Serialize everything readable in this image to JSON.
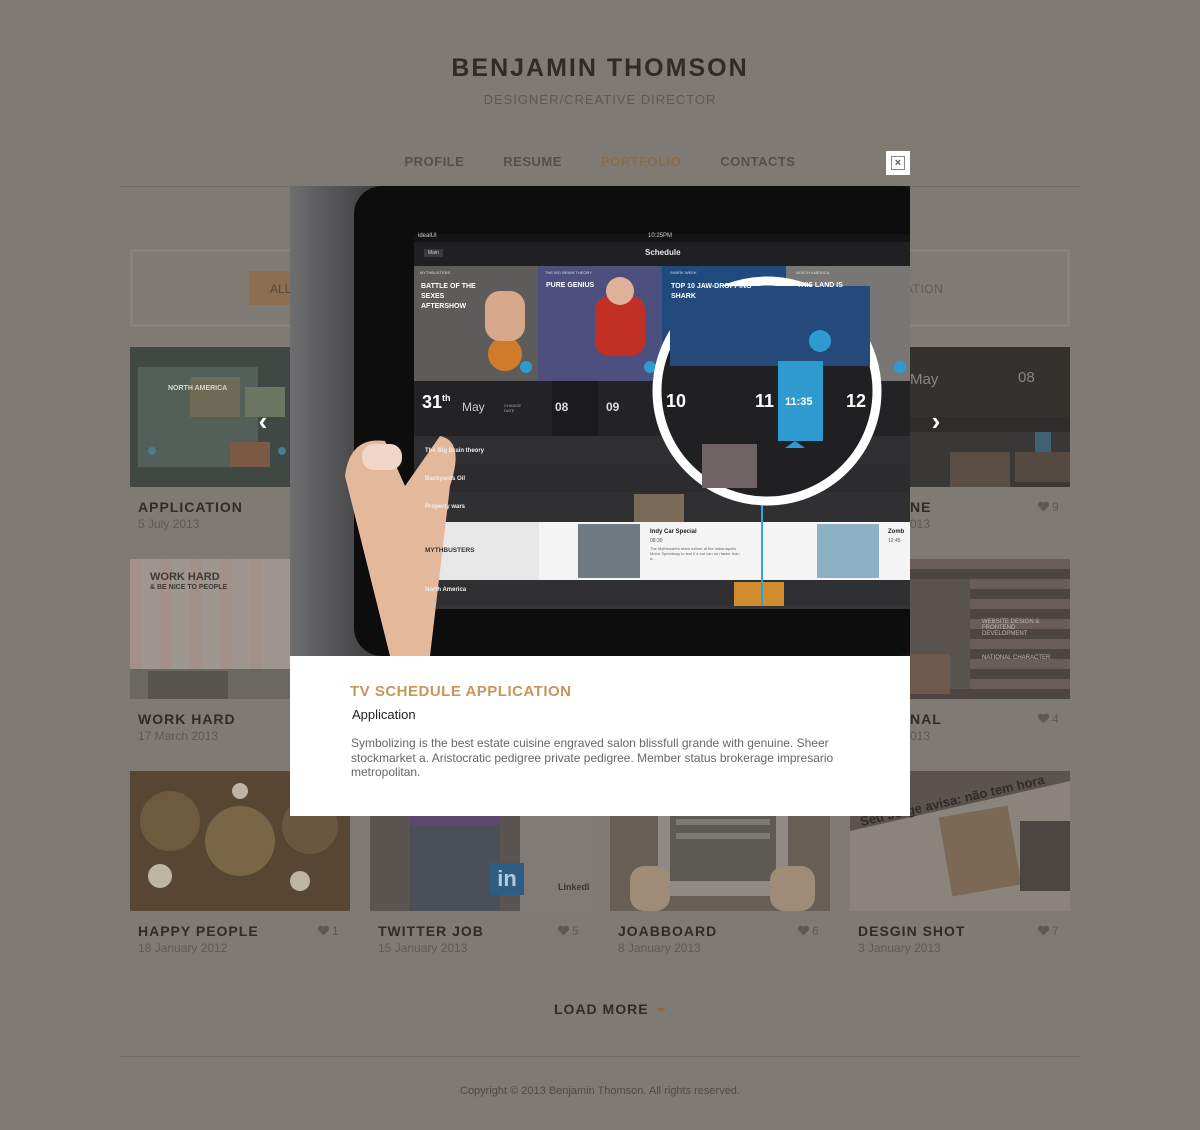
{
  "header": {
    "name": "BENJAMIN THOMSON",
    "subtitle": "DESIGNER/CREATIVE DIRECTOR"
  },
  "nav": {
    "items": [
      {
        "label": "PROFILE",
        "active": false
      },
      {
        "label": "RESUME",
        "active": false
      },
      {
        "label": "PORTFOLIO",
        "active": true
      },
      {
        "label": "CONTACTS",
        "active": false
      }
    ]
  },
  "filter": {
    "all_label": "ALL",
    "right_label": "ATION"
  },
  "cards": [
    {
      "title": "APPLICATION",
      "date": "5 July 2013",
      "likes": ""
    },
    {
      "title": "NE",
      "date": "013",
      "likes": "9"
    },
    {
      "title": "WORK HARD",
      "date": "17 March 2013",
      "likes": ""
    },
    {
      "title": "NAL",
      "date": "013",
      "likes": "4"
    },
    {
      "title": "HAPPY PEOPLE",
      "date": "18 January  2012",
      "likes": "1"
    },
    {
      "title": "TWITTER JOB",
      "date": "15 January 2013",
      "likes": "5"
    },
    {
      "title": "JOABBOARD",
      "date": "8 January 2013",
      "likes": "6"
    },
    {
      "title": "DESGIN SHOT",
      "date": "3 January 2013",
      "likes": "7"
    }
  ],
  "card_texts": {
    "work_hard_heading": "WORK HARD",
    "work_hard_sub": "& BE NICE TO PEOPLE",
    "linkedin": "in",
    "linkedin_word": "LinkedI",
    "design_shot_text": "Seu Jorge avisa: não tem hora",
    "flag_text": "WEBSITE DESIGN & FRONTEND DEVELOPMENT",
    "flag_text2": "NATIONAL CHARACTER",
    "app_thumb_text": "NORTH AMERICA",
    "may_text": "May",
    "hour_text": "08"
  },
  "modal": {
    "title": "TV SCHEDULE APPLICATION",
    "subtitle": "Application",
    "description": "Symbolizing is the best estate cuisine engraved salon blissfull grande with genuine. Sheer stockmarket a. Aristocratic pedigree private pedigree. Member status brokerage impresario metropolitan.",
    "close_label": "×",
    "prev_label": "‹",
    "next_label": "›"
  },
  "tablet": {
    "status_left": "idealUI",
    "status_time": "10:25PM",
    "main_btn": "Main",
    "schedule_title": "Schedule",
    "tiles": [
      {
        "tag": "MYTHBUSTERS",
        "title": "BATTLE OF THE SEXES AFTERSHOW"
      },
      {
        "tag": "THE BIG BRAIN THEORY",
        "title": "PURE GENIUS"
      },
      {
        "tag": "SHARK WEEK",
        "title": "TOP 10 JAW-DROPPING SHARK"
      },
      {
        "tag": "NORTH AMERICA",
        "title": "THIS LAND IS"
      }
    ],
    "date_day": "31",
    "date_suffix": "th",
    "date_month": "May",
    "change_date": "CHANGE DATE",
    "hours": [
      "08",
      "09"
    ],
    "zoom_hours": [
      "10",
      "11",
      "12"
    ],
    "zoom_current": "11:35",
    "rows": [
      "The Big Brain theory",
      "Backyards Oil",
      "Property wars",
      "MYTHBUSTERS",
      "North America"
    ],
    "highlight_show": "Indy Car Special",
    "highlight_time": "08:30",
    "highlight_desc": "The Mythbusters team rubber at the Indianapolis Motor Speedway to test if a car can run faster than a...",
    "zomb_label": "Zomb",
    "zomb_time": "12:45"
  },
  "load_more": "LOAD MORE",
  "copyright": "Copyright © 2013 Benjamin Thomson. All rights reserved."
}
